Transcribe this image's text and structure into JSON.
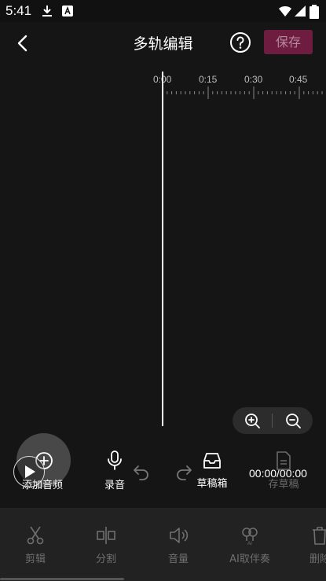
{
  "status_bar": {
    "time": "5:41"
  },
  "header": {
    "title": "多轨编辑",
    "save_label": "保存"
  },
  "ruler": {
    "marks": [
      "0:00",
      "0:15",
      "0:30",
      "0:45"
    ]
  },
  "tools": {
    "add_audio": "添加音频",
    "record": "录音",
    "drafts": "草稿箱",
    "save_draft": "存草稿",
    "time_readout": "00:00/00:00"
  },
  "bottom_toolbar": {
    "items": [
      {
        "label": "剪辑",
        "icon": "scissors-icon"
      },
      {
        "label": "分割",
        "icon": "split-icon"
      },
      {
        "label": "音量",
        "icon": "volume-icon"
      },
      {
        "label": "AI取伴奏",
        "icon": "ai-accompaniment-icon"
      },
      {
        "label": "删除",
        "icon": "trash-icon"
      }
    ]
  },
  "colors": {
    "accent": "#6e1d41",
    "background": "#151515",
    "toolbar": "#222222"
  }
}
